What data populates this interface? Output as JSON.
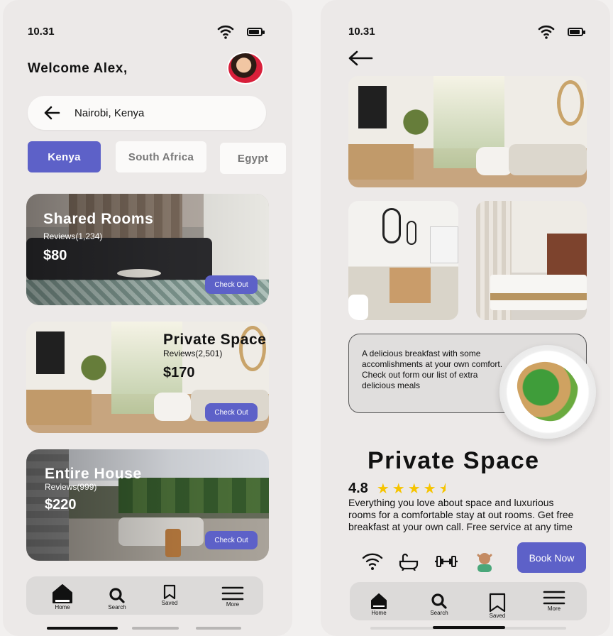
{
  "left_screen": {
    "status_time": "10.31",
    "welcome": "Welcome Alex,",
    "search": {
      "text": "Nairobi, Kenya"
    },
    "chips": [
      "Kenya",
      "South Africa",
      "Egypt"
    ],
    "listings": [
      {
        "title": "Shared Rooms",
        "reviews": "Reviews(1,234)",
        "price": "$80",
        "cta": "Check Out"
      },
      {
        "title": "Private Space",
        "reviews": "Reviews(2,501)",
        "price": "$170",
        "cta": "Check Out"
      },
      {
        "title": "Entire House",
        "reviews": "Reviews(999)",
        "price": "$220",
        "cta": "Check Out"
      }
    ],
    "tabs": [
      "Home",
      "Search",
      "Saved",
      "More"
    ]
  },
  "right_screen": {
    "status_time": "10.31",
    "breakfast_text": "A delicious breakfast with some accomlishments at your own comfort. Check out form our list of extra delicious meals",
    "title": "Private Space",
    "rating": "4.8",
    "rating_stars": 4.5,
    "description": "Everything you love about space and luxurious rooms for a  comfortable stay at out rooms. Get free breakfast at your own call. Free service at any time",
    "amenities": [
      "wifi-icon",
      "bathtub-icon",
      "gym-icon",
      "massage-icon"
    ],
    "cta": "Book Now",
    "tabs": [
      "Home",
      "Search",
      "Saved",
      "More"
    ]
  },
  "colors": {
    "accent": "#5d61c8",
    "star": "#f6c400",
    "background": "#ece9e8"
  }
}
